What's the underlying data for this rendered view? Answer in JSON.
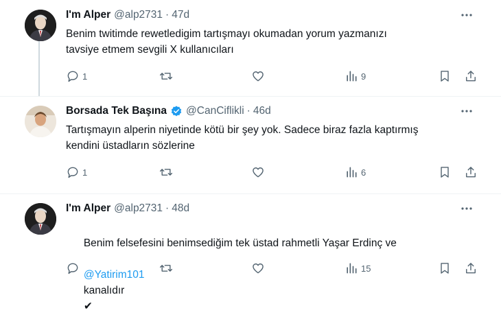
{
  "tweets": [
    {
      "name": "I'm Alper",
      "handle": "@alp2731",
      "time": "47d",
      "text": "Benim twitimde rewetledigim tartışmayı okumadan yorum yazmanızı\ntavsiye etmem sevgili X kullanıcıları",
      "replies": "1",
      "retweets": "",
      "likes": "",
      "views": "9"
    },
    {
      "name": "Borsada Tek Başına",
      "handle": "@CanCiflikli",
      "time": "46d",
      "verified": true,
      "text": "Tartışmayın alperin niyetinde kötü bir şey yok. Sadece biraz fazla kaptırmış\nkendini üstadların sözlerine",
      "replies": "1",
      "retweets": "",
      "likes": "",
      "views": "6"
    },
    {
      "name": "I'm Alper",
      "handle": "@alp2731",
      "time": "48d",
      "text_line1": "Benim felsefesini benimsediğim tek üstad rahmetli Yaşar Erdinç ve",
      "mention": "@Yatirim101",
      "text_line2_rest": "kanalıdır",
      "replies": "",
      "retweets": "",
      "likes": "",
      "views": "15"
    }
  ],
  "separator": "·",
  "check_mark": "✔",
  "colors": {
    "accent": "#1d9bf0",
    "secondary_text": "#536471",
    "primary_text": "#0f1419",
    "divider": "#eff3f4"
  },
  "icons": [
    "reply-icon",
    "retweet-icon",
    "like-icon",
    "views-icon",
    "bookmark-icon",
    "share-icon",
    "more-icon",
    "verified-badge-icon"
  ]
}
